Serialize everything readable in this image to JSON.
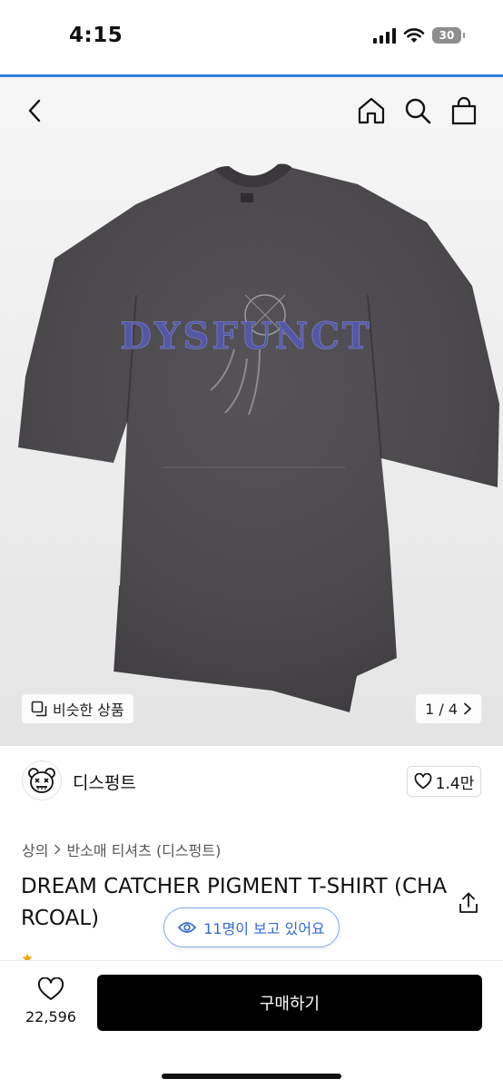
{
  "status_bar": {
    "time": "4:15",
    "battery": "30"
  },
  "nav": {
    "back_icon": "chevron-left-icon",
    "home_icon": "home-icon",
    "search_icon": "search-icon",
    "cart_icon": "shopping-bag-icon"
  },
  "gallery": {
    "graphic_text": "DYSFUNCT",
    "similar_label": "비슷한 상품",
    "page_indicator": "1 / 4"
  },
  "brand": {
    "name": "디스펑트",
    "likes": "1.4만"
  },
  "breadcrumb": {
    "category": "상의",
    "subcategory": "반소매 티셔츠 (디스펑트)"
  },
  "product": {
    "title": "DREAM CATCHER PIGMENT T-SHIRT (CHARCOAL)"
  },
  "viewers": {
    "label": "11명이 보고 있어요"
  },
  "bottom_bar": {
    "wish_count": "22,596",
    "buy_label": "구매하기"
  },
  "colors": {
    "accent_blue": "#2f7fe6",
    "pill_text": "#3469d6",
    "shirt": "#4a484b",
    "button": "#000000"
  }
}
